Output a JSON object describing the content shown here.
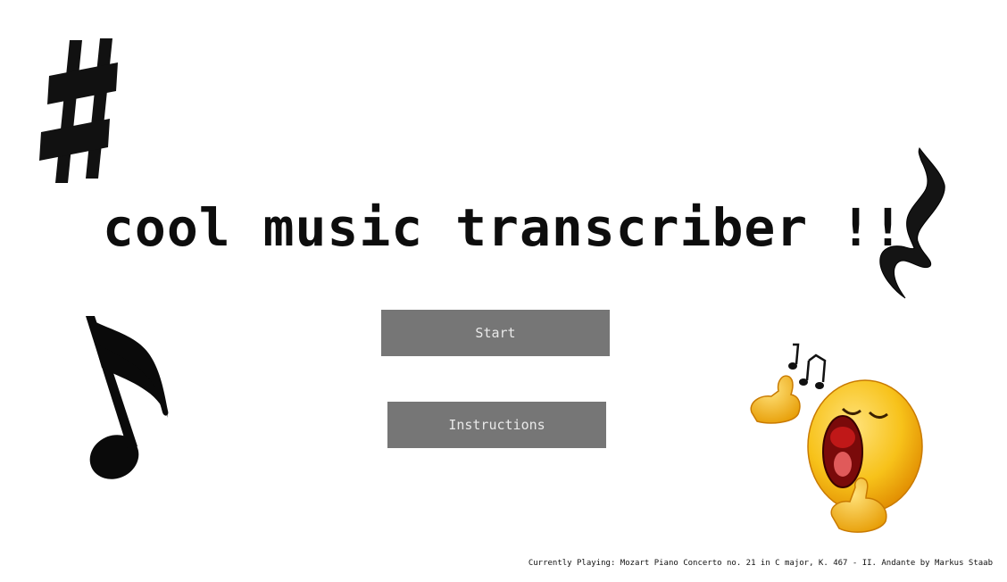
{
  "app": {
    "title": "cool music transcriber !!"
  },
  "menu": {
    "start_label": "Start",
    "instructions_label": "Instructions"
  },
  "footer": {
    "now_playing": "Currently Playing: Mozart Piano Concerto no. 21 in C major, K. 467 - II. Andante by Markus Staab"
  },
  "decorations": {
    "icons": [
      "sharp-icon",
      "quarter-rest-icon",
      "eighth-note-icon",
      "singing-emoji-icon"
    ]
  },
  "colors": {
    "button_bg": "#767676",
    "button_text": "#e9e9e9",
    "title": "#0d0d0d",
    "emoji": "#f7c21a"
  }
}
